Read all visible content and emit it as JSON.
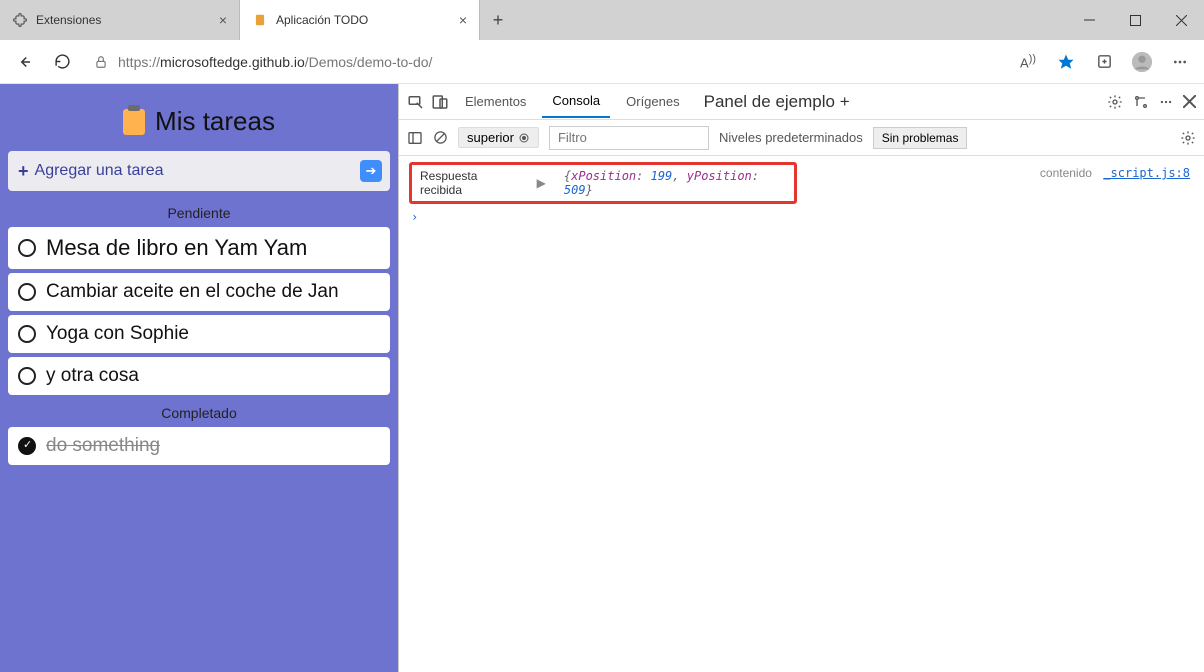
{
  "tabs": [
    {
      "label": "Extensiones",
      "active": false
    },
    {
      "label": "Aplicación TODO",
      "active": true
    }
  ],
  "url": {
    "host": "microsoftedge.github.io",
    "path": "/Demos/demo-to-do/",
    "prefix": "https://"
  },
  "app": {
    "title": "Mis tareas",
    "add_placeholder": "Agregar una tarea",
    "pending_label": "Pendiente",
    "completed_label": "Completado",
    "pending": [
      "Mesa de libro en Yam Yam",
      "Cambiar aceite en el coche de Jan",
      "Yoga con Sophie",
      "y otra cosa"
    ],
    "completed": [
      "do something"
    ]
  },
  "devtools": {
    "tabs": {
      "elements": "Elementos",
      "console": "Consola",
      "sources": "Orígenes",
      "sample": "Panel de ejemplo +"
    },
    "toolbar": {
      "scope": "superior",
      "filter_placeholder": "Filtro",
      "levels": "Niveles predeterminados",
      "issues": "Sin problemas"
    },
    "log": {
      "label": "Respuesta recibida",
      "object": {
        "xPosition": 199,
        "yPosition": 509
      },
      "context": "contenido",
      "source": "_script.js:8"
    }
  }
}
